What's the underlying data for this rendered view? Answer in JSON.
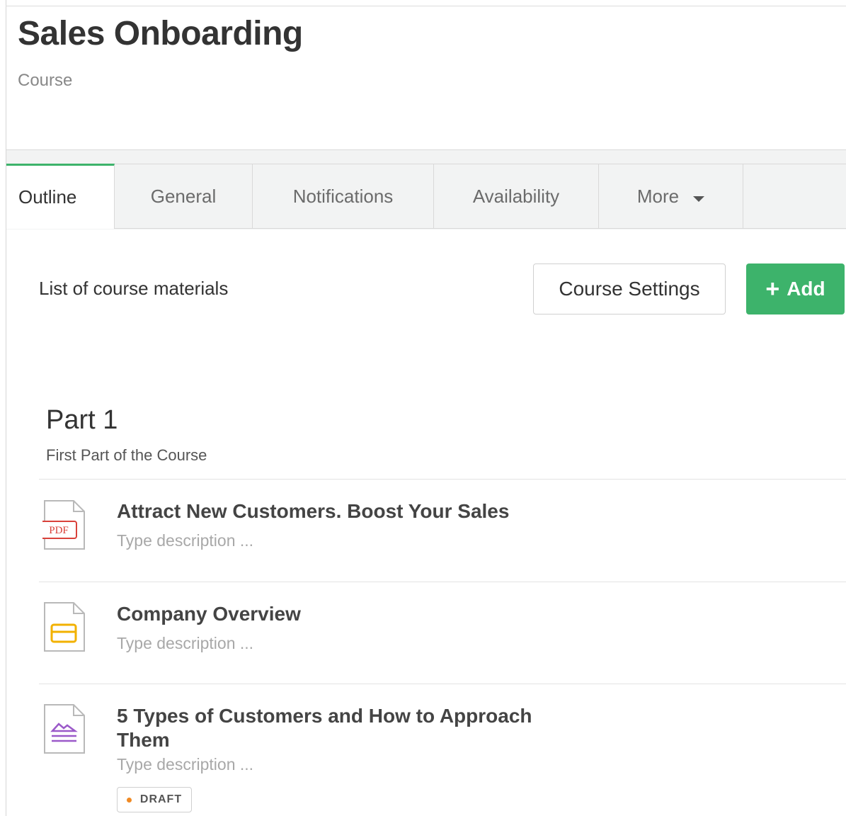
{
  "header": {
    "title": "Sales Onboarding",
    "subtitle": "Course"
  },
  "tabs": [
    {
      "label": "Outline",
      "active": true
    },
    {
      "label": "General"
    },
    {
      "label": "Notifications"
    },
    {
      "label": "Availability"
    },
    {
      "label": "More",
      "icon": "caret-down-icon"
    }
  ],
  "toolbar": {
    "list_label": "List of course materials",
    "settings_label": "Course Settings",
    "add_label": "Add",
    "add_icon": "plus-icon",
    "accent_color": "#3db36b"
  },
  "section": {
    "title": "Part 1",
    "description": "First Part of the Course"
  },
  "items": [
    {
      "title": "Attract New Customers. Boost Your Sales",
      "description": "Type description ...",
      "icon": "pdf-file-icon",
      "icon_text": "PDF",
      "icon_color": "#d9413a"
    },
    {
      "title": "Company Overview",
      "description": "Type description ...",
      "icon": "presentation-file-icon",
      "icon_color": "#f2b100"
    },
    {
      "title": "5 Types of Customers and How to Approach Them",
      "description": "Type description ...",
      "icon": "article-file-icon",
      "icon_color": "#9b59c9",
      "status": "DRAFT",
      "status_color": "#f08a24"
    }
  ]
}
